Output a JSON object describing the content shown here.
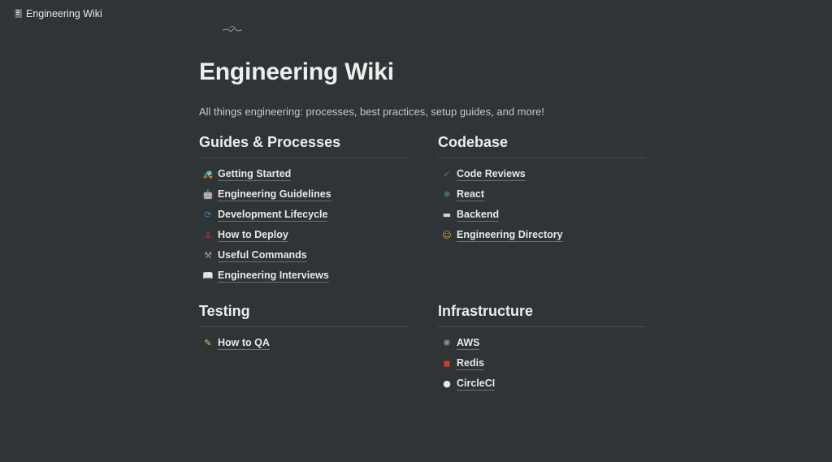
{
  "topbar": {
    "breadcrumb_title": "Engineering Wiki",
    "breadcrumb_icon": "book-icon"
  },
  "page": {
    "title": "Engineering Wiki",
    "description": "All things engineering: processes, best practices, setup guides, and more!"
  },
  "sections": {
    "guides": {
      "title": "Guides & Processes",
      "items": [
        {
          "label": "Getting Started",
          "icon": "tractor-icon",
          "glyph": "🚜",
          "color": "#d6a21e"
        },
        {
          "label": "Engineering Guidelines",
          "icon": "robot-icon",
          "glyph": "🤖",
          "color": "#8fa4b5"
        },
        {
          "label": "Development Lifecycle",
          "icon": "cycle-icon",
          "glyph": "⟳",
          "color": "#3a86c8"
        },
        {
          "label": "How to Deploy",
          "icon": "ship-icon",
          "glyph": "⚓",
          "color": "#c0392b"
        },
        {
          "label": "Useful Commands",
          "icon": "tools-icon",
          "glyph": "⚒",
          "color": "#9aa0a6"
        },
        {
          "label": "Engineering Interviews",
          "icon": "open-book-icon",
          "glyph": "📖",
          "color": "#bfc4c9"
        }
      ]
    },
    "codebase": {
      "title": "Codebase",
      "items": [
        {
          "label": "Code Reviews",
          "icon": "checkmark-icon",
          "glyph": "✔",
          "color": "#555b60"
        },
        {
          "label": "React",
          "icon": "react-atom-icon",
          "glyph": "⚛",
          "color": "#5ecdf0"
        },
        {
          "label": "Backend",
          "icon": "computer-icon",
          "glyph": "▬",
          "color": "#cfd3d6"
        },
        {
          "label": "Engineering Directory",
          "icon": "person-icon",
          "glyph": "☺",
          "color": "#e0a930"
        }
      ]
    },
    "testing": {
      "title": "Testing",
      "items": [
        {
          "label": "How to QA",
          "icon": "memo-icon",
          "glyph": "✎",
          "color": "#e3c35a"
        }
      ]
    },
    "infrastructure": {
      "title": "Infrastructure",
      "items": [
        {
          "label": "AWS",
          "icon": "aws-icon",
          "glyph": "✺",
          "color": "#8a8f94"
        },
        {
          "label": "Redis",
          "icon": "redis-icon",
          "glyph": "◼",
          "color": "#d9352b"
        },
        {
          "label": "CircleCI",
          "icon": "circleci-icon",
          "glyph": "●",
          "color": "#e9e9e9"
        }
      ]
    }
  },
  "colors": {
    "background": "#2f3437",
    "text": "#e8e8e8",
    "divider": "#474c50"
  }
}
